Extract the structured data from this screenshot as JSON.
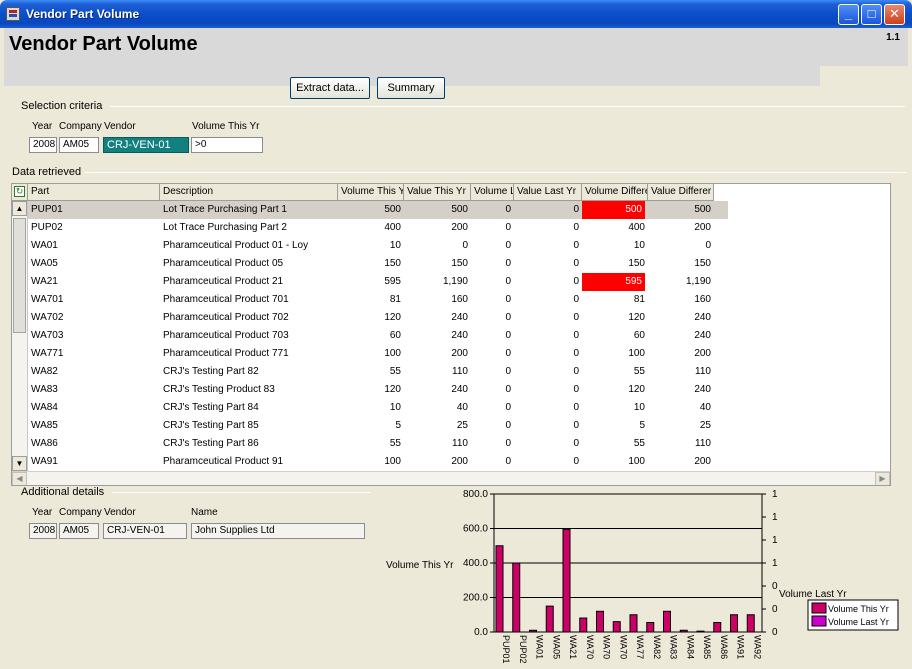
{
  "window": {
    "title": "Vendor Part Volume"
  },
  "header": {
    "title": "Vendor Part Volume",
    "version": "1.1"
  },
  "toolbar": {
    "extract_label": "Extract data...",
    "summary_label": "Summary"
  },
  "selection": {
    "label": "Selection criteria",
    "year_label": "Year",
    "company_label": "Company",
    "vendor_label": "Vendor",
    "volume_label": "Volume This Yr",
    "year": "2008",
    "company": "AM05",
    "vendor": "CRJ-VEN-01",
    "volume": ">0"
  },
  "data_section": {
    "label": "Data retrieved"
  },
  "table": {
    "columns": [
      "Part",
      "Description",
      "Volume This Y",
      "Value This Yr",
      "Volume L",
      "Value Last Yr",
      "Volume Differe",
      "Value Differer"
    ],
    "rows": [
      [
        "PUP01",
        "Lot Trace Purchasing Part 1",
        "500",
        "500",
        "0",
        "0",
        "500",
        "500"
      ],
      [
        "PUP02",
        "Lot Trace Purchasing Part 2",
        "400",
        "200",
        "0",
        "0",
        "400",
        "200"
      ],
      [
        "WA01",
        "Pharamceutical Product 01 - Loy",
        "10",
        "0",
        "0",
        "0",
        "10",
        "0"
      ],
      [
        "WA05",
        "Pharamceutical Product 05",
        "150",
        "150",
        "0",
        "0",
        "150",
        "150"
      ],
      [
        "WA21",
        "Pharamceutical Product 21",
        "595",
        "1,190",
        "0",
        "0",
        "595",
        "1,190"
      ],
      [
        "WA701",
        "Pharamceutical Product 701",
        "81",
        "160",
        "0",
        "0",
        "81",
        "160"
      ],
      [
        "WA702",
        "Pharamceutical Product 702",
        "120",
        "240",
        "0",
        "0",
        "120",
        "240"
      ],
      [
        "WA703",
        "Pharamceutical Product 703",
        "60",
        "240",
        "0",
        "0",
        "60",
        "240"
      ],
      [
        "WA771",
        "Pharamceutical Product 771",
        "100",
        "200",
        "0",
        "0",
        "100",
        "200"
      ],
      [
        "WA82",
        "CRJ's Testing Part 82",
        "55",
        "110",
        "0",
        "0",
        "55",
        "110"
      ],
      [
        "WA83",
        "CRJ's Testing Product 83",
        "120",
        "240",
        "0",
        "0",
        "120",
        "240"
      ],
      [
        "WA84",
        "CRJ's Testing Part 84",
        "10",
        "40",
        "0",
        "0",
        "10",
        "40"
      ],
      [
        "WA85",
        "CRJ's Testing Part 85",
        "5",
        "25",
        "0",
        "0",
        "5",
        "25"
      ],
      [
        "WA86",
        "CRJ's Testing Part 86",
        "55",
        "110",
        "0",
        "0",
        "55",
        "110"
      ],
      [
        "WA91",
        "Pharamceutical Product 91",
        "100",
        "200",
        "0",
        "0",
        "100",
        "200"
      ]
    ],
    "selected_row": 0,
    "highlight_rows": [
      0,
      4
    ]
  },
  "additional": {
    "label": "Additional details",
    "year_label": "Year",
    "company_label": "Company",
    "vendor_label": "Vendor",
    "name_label": "Name",
    "year": "2008",
    "company": "AM05",
    "vendor": "CRJ-VEN-01",
    "name": "John Supplies Ltd"
  },
  "colors": {
    "volume_this_yr": "#cc0066",
    "volume_last_yr": "#cc00cc",
    "highlight": "#ff0000",
    "selected_field": "#138080"
  },
  "chart_data": {
    "type": "bar",
    "categories": [
      "PUP01",
      "PUP02",
      "WA01",
      "WA05",
      "WA21",
      "WA70",
      "WA70",
      "WA70",
      "WA77",
      "WA82",
      "WA83",
      "WA84",
      "WA85",
      "WA86",
      "WA91",
      "WA92"
    ],
    "series": [
      {
        "name": "Volume This Yr",
        "values": [
          500,
          400,
          10,
          150,
          595,
          81,
          120,
          60,
          100,
          55,
          120,
          10,
          5,
          55,
          100,
          100
        ]
      },
      {
        "name": "Volume Last Yr",
        "values": [
          0,
          0,
          0,
          0,
          0,
          0,
          0,
          0,
          0,
          0,
          0,
          0,
          0,
          0,
          0,
          0
        ]
      }
    ],
    "ylabel": "Volume This Yr",
    "y2label": "Volume Last Yr",
    "yticks": [
      "0.0",
      "200.0",
      "400.0",
      "600.0",
      "800.0"
    ],
    "y2ticks": [
      "0",
      "0",
      "0",
      "1",
      "1",
      "1",
      "1"
    ],
    "ylim": [
      0,
      800
    ],
    "legend": "right",
    "grid": true
  }
}
